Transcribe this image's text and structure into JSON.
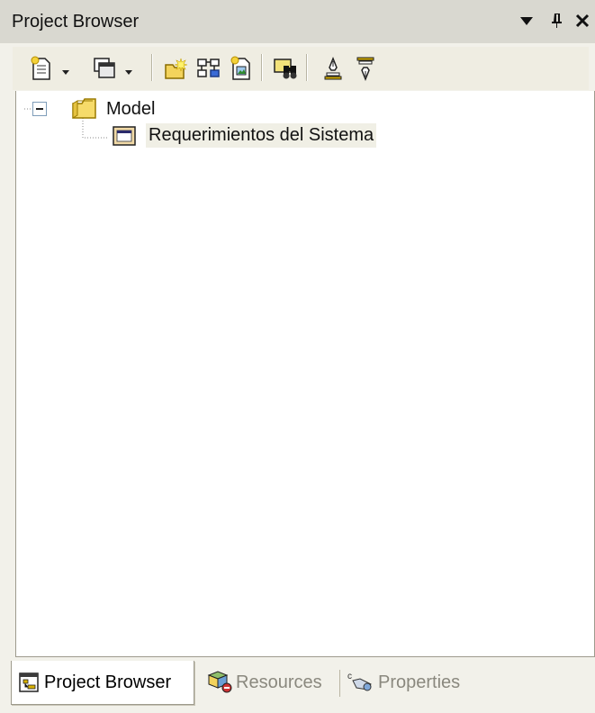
{
  "window": {
    "title": "Project Browser",
    "icons": [
      "dropdown-arrow-icon",
      "pin-icon",
      "close-icon"
    ]
  },
  "toolbar": {
    "icons": [
      "new-element-icon",
      "new-diagram-icon",
      "new-package-icon",
      "show-hierarchy-icon",
      "new-document-icon",
      "find-icon",
      "checkin-icon",
      "checkout-icon"
    ]
  },
  "tree": {
    "root": {
      "label": "Model",
      "icon": "package-folder-icon",
      "expander": "minus-box-icon"
    },
    "children": [
      {
        "label": "Requerimientos del Sistema",
        "icon": "diagram-icon",
        "selected": true
      }
    ]
  },
  "tabs": [
    {
      "label": "Project Browser",
      "icon": "project-browser-icon",
      "active": true
    },
    {
      "label": "Resources",
      "icon": "resources-icon",
      "active": false
    },
    {
      "label": "Properties",
      "icon": "properties-icon",
      "active": false
    }
  ],
  "colors": {
    "selected_row": "#f0efe5",
    "chrome": "#d9d8d0",
    "inactive_tab_text": "#8a887e"
  }
}
